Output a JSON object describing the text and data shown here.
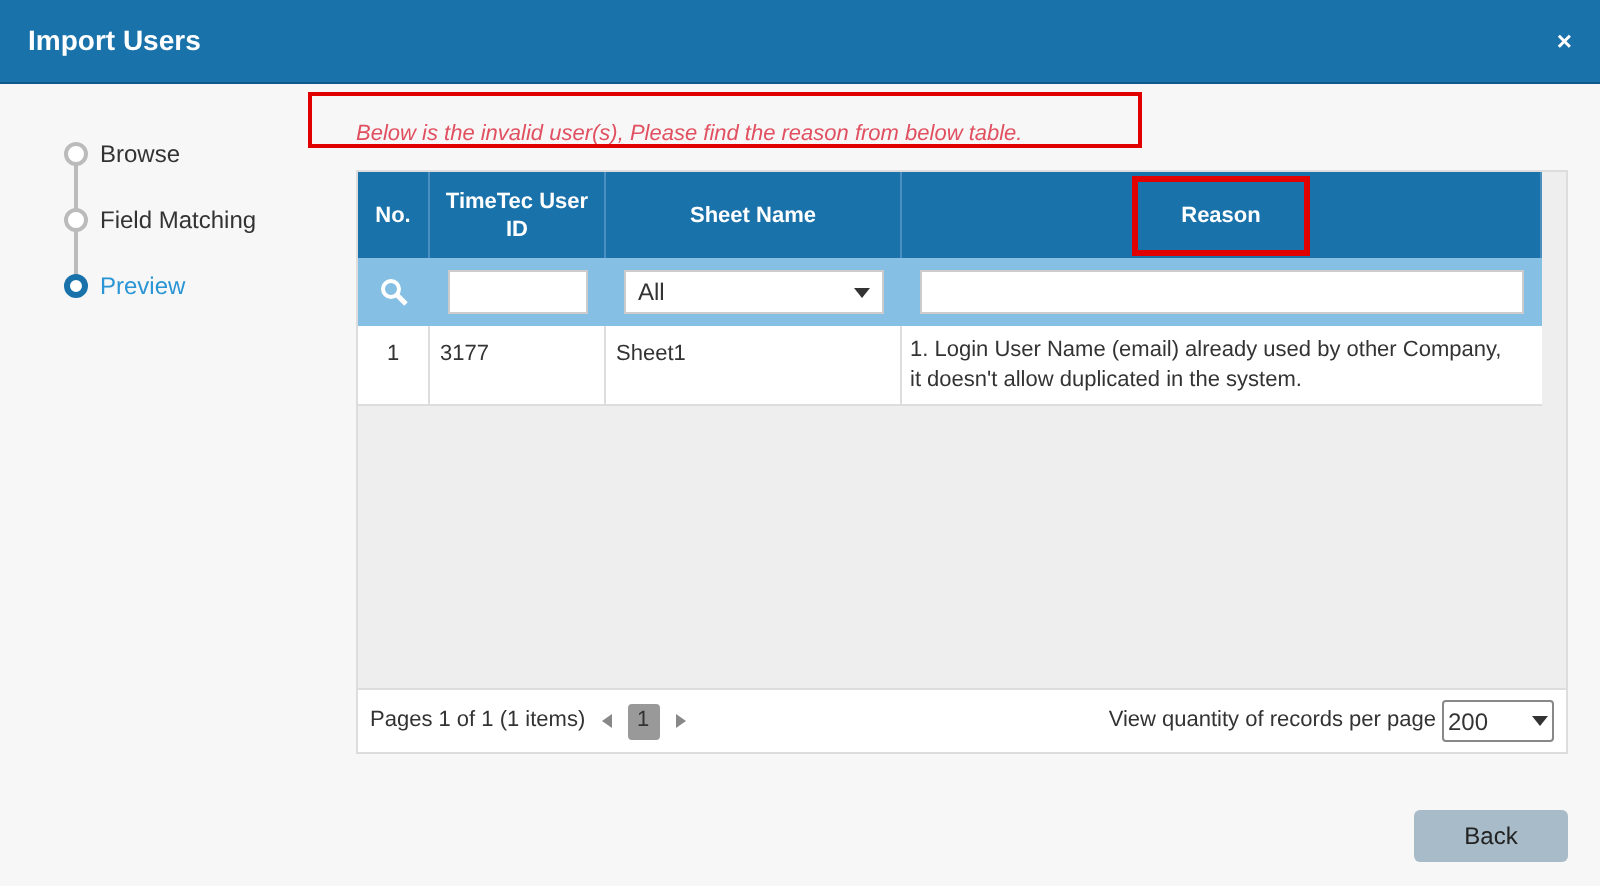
{
  "window": {
    "title": "Import Users",
    "close": "×"
  },
  "steps": [
    {
      "label": "Browse",
      "selected": false
    },
    {
      "label": "Field Matching",
      "selected": false
    },
    {
      "label": "Preview",
      "selected": true
    }
  ],
  "message": "Below is the invalid user(s), Please find the reason from below table.",
  "table": {
    "columns": [
      {
        "label": "No.",
        "highlighted": false
      },
      {
        "label": "TimeTec User ID",
        "highlighted": false
      },
      {
        "label": "Sheet Name",
        "highlighted": false
      },
      {
        "label": "Reason",
        "highlighted": true
      }
    ],
    "filters": {
      "sheet_value": "All"
    },
    "rows": [
      {
        "no": "1",
        "user_id": "3177",
        "sheet": "Sheet1",
        "reason": "1. Login User Name (email) already used by other Company, it doesn't allow duplicated in the system."
      }
    ]
  },
  "pager": {
    "summary": "Pages 1 of 1 (1 items)",
    "pages": [
      {
        "label": "1",
        "selected": true
      }
    ],
    "per_page_label": "View quantity of records per page",
    "per_page": "200"
  },
  "buttons": [
    {
      "label": "Back"
    }
  ]
}
